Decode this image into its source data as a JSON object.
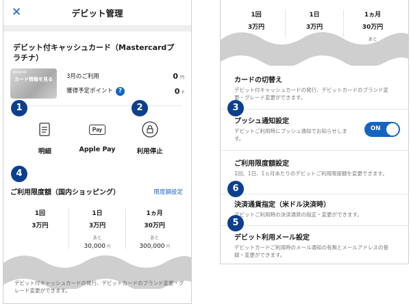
{
  "left": {
    "header": {
      "close_icon": "close-icon",
      "title": "デビット管理"
    },
    "card": {
      "title": "デビット付キャッシュカード（Mastercardプラチナ）",
      "image_brand": "NEOBANK",
      "image_label": "カード情報を見る",
      "usage_label": "3月のご利用",
      "usage_value": "0",
      "usage_unit": "円",
      "points_label": "獲得予定ポイント",
      "points_value": "0",
      "points_unit": "P",
      "help_icon": "?"
    },
    "actions": [
      {
        "label": "明細",
        "icon": "statement-icon"
      },
      {
        "label": "Apple Pay",
        "icon": "apple-pay-icon",
        "icon_text": "Pay"
      },
      {
        "label": "利用停止",
        "icon": "lock-icon"
      }
    ],
    "limit": {
      "title": "ご利用限度額（国内ショッピング）",
      "link": "限度額設定",
      "columns": [
        {
          "period": "1回",
          "amount": "3万円",
          "remaining_label": "",
          "remaining": "",
          "unit": ""
        },
        {
          "period": "1日",
          "amount": "3万円",
          "remaining_label": "あと",
          "remaining": "30,000",
          "unit": "円"
        },
        {
          "period": "1ヵ月",
          "amount": "30万円",
          "remaining_label": "あと",
          "remaining": "300,000",
          "unit": "円"
        }
      ]
    },
    "bottom_text": "デビット付キャッシュカードの発行、デビットカードのブランド変更・グレード変更ができます。"
  },
  "right": {
    "limits": [
      {
        "period": "1回",
        "amount": "3万円",
        "remaining_label": ""
      },
      {
        "period": "1日",
        "amount": "3万円",
        "remaining_label": "あと"
      },
      {
        "period": "1ヵ月",
        "amount": "30万円",
        "remaining_label": "あと"
      }
    ],
    "items": [
      {
        "title": "カードの切替え",
        "desc": "デビット付キャッシュカードの発行、デビットカードのブランド変更・グレード変更ができます。"
      },
      {
        "title": "プッシュ通知設定",
        "desc": "デビットご利用時にプッシュ通知でお知らせします。",
        "toggle": "ON"
      },
      {
        "title": "ご利用限度額設定",
        "desc": "1回、1日、1ヵ月あたりのデビットご利用限度額を変更できます。"
      },
      {
        "title": "決済通貨指定（米ドル決済時）",
        "desc": "デビットご利用時の決済通貨の指定・変更ができます。"
      },
      {
        "title": "デビット利用メール設定",
        "desc": "デビットカードご利用時のメール通知の有無とメールアドレスの登録・変更ができます。"
      }
    ]
  },
  "badges": [
    "1",
    "2",
    "4",
    "3",
    "6",
    "5"
  ],
  "colors": {
    "accent": "#1565c0",
    "badge": "#0d3f8f",
    "wave": "#cfcfcf"
  }
}
